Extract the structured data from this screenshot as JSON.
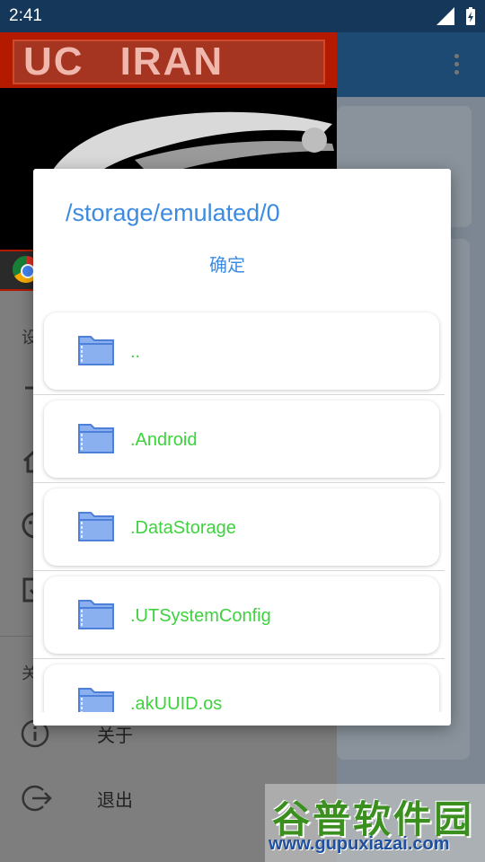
{
  "status_bar": {
    "time": "2:41"
  },
  "drawer": {
    "banner_text_left": "UC",
    "banner_text_right": "IRAN",
    "section_top_label": "设",
    "section_bottom_label": "关",
    "items": [
      {
        "icon": "info-icon",
        "label": "关于"
      },
      {
        "icon": "logout-icon",
        "label": "退出"
      }
    ]
  },
  "dialog": {
    "path": "/storage/emulated/0",
    "confirm_label": "确定",
    "files": [
      {
        "name": "..",
        "icon": "folder-icon"
      },
      {
        "name": ".Android",
        "icon": "folder-icon"
      },
      {
        "name": ".DataStorage",
        "icon": "folder-icon"
      },
      {
        "name": ".UTSystemConfig",
        "icon": "folder-icon"
      },
      {
        "name": ".akUUID.os",
        "icon": "folder-icon"
      }
    ]
  },
  "watermark": {
    "title": "谷普软件园",
    "url": "www.gupuxiazai.com"
  },
  "colors": {
    "accent": "#3d8be0",
    "file_name": "#3ed23e",
    "status_bar": "#15375a"
  }
}
